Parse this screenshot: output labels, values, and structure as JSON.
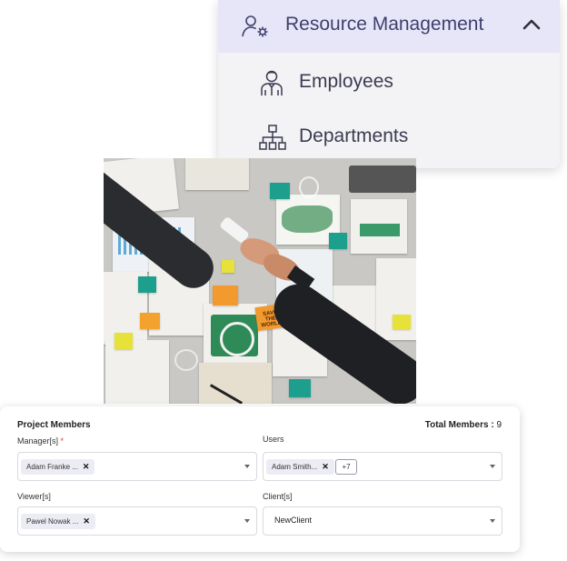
{
  "menu": {
    "title": "Resource Management",
    "title_icon": "user-gear-icon",
    "collapse_icon": "chevron-up-icon",
    "items": [
      {
        "label": "Employees",
        "icon": "employee-icon"
      },
      {
        "label": "Departments",
        "icon": "org-chart-icon"
      }
    ],
    "colors": {
      "header_bg": "#e6e6f8",
      "menu_bg": "#f3f3f5",
      "text": "#3f3f6e"
    }
  },
  "photo": {
    "description_icon": "business-handshake-photo",
    "sticky_note_text": "SAVE THE WORLD"
  },
  "project_members": {
    "title": "Project Members",
    "total_label": "Total Members :",
    "total_value": "9",
    "manager": {
      "label": "Manager[s]",
      "required_mark": "*",
      "chips": [
        "Adam Franke ..."
      ]
    },
    "users": {
      "label": "Users",
      "chips": [
        "Adam Smith..."
      ],
      "more": "+7"
    },
    "viewer": {
      "label": "Viewer[s]",
      "chips": [
        "Pawel Nowak ..."
      ]
    },
    "client": {
      "label": "Client[s]",
      "value": "NewClient"
    },
    "chip_remove": "✕"
  }
}
